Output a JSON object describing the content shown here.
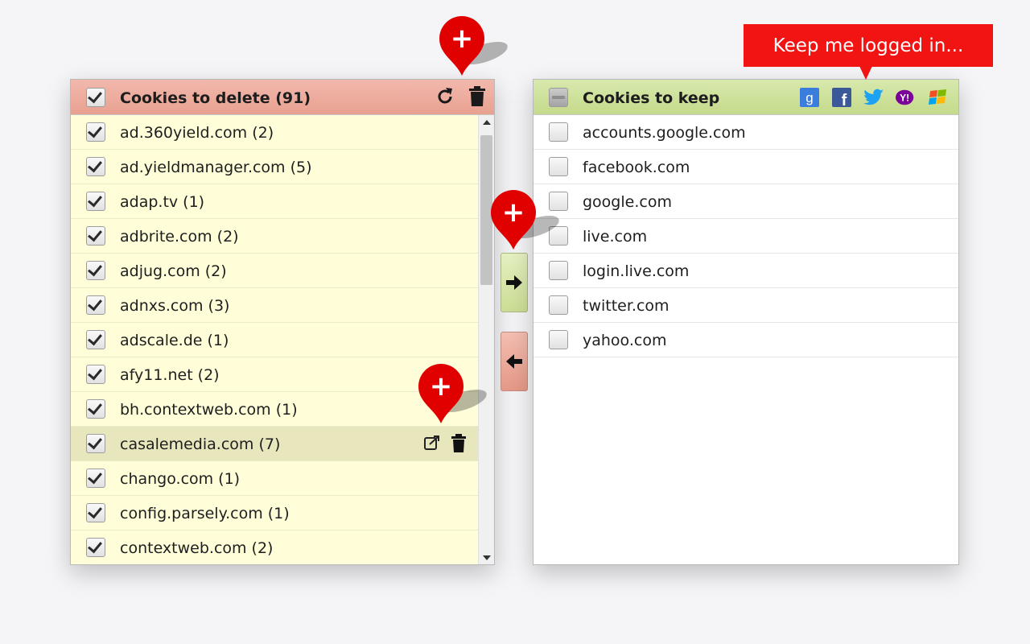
{
  "delete_panel": {
    "title": "Cookies to delete (91)",
    "items": [
      {
        "label": "ad.360yield.com (2)",
        "checked": true
      },
      {
        "label": "ad.yieldmanager.com (5)",
        "checked": true
      },
      {
        "label": "adap.tv (1)",
        "checked": true
      },
      {
        "label": "adbrite.com (2)",
        "checked": true
      },
      {
        "label": "adjug.com (2)",
        "checked": true
      },
      {
        "label": "adnxs.com (3)",
        "checked": true
      },
      {
        "label": "adscale.de (1)",
        "checked": true
      },
      {
        "label": "afy11.net (2)",
        "checked": true
      },
      {
        "label": "bh.contextweb.com (1)",
        "checked": true
      },
      {
        "label": "casalemedia.com (7)",
        "checked": true,
        "hovered": true
      },
      {
        "label": "chango.com (1)",
        "checked": true
      },
      {
        "label": "config.parsely.com (1)",
        "checked": true
      },
      {
        "label": "contextweb.com (2)",
        "checked": true
      }
    ],
    "header_icons": [
      "refresh-icon",
      "trash-icon"
    ],
    "row_action_icons": [
      "open-external-icon",
      "trash-icon"
    ]
  },
  "keep_panel": {
    "title": "Cookies to keep",
    "items": [
      {
        "label": "accounts.google.com",
        "checked": false
      },
      {
        "label": "facebook.com",
        "checked": false
      },
      {
        "label": "google.com",
        "checked": false
      },
      {
        "label": "live.com",
        "checked": false
      },
      {
        "label": "login.live.com",
        "checked": false
      },
      {
        "label": "twitter.com",
        "checked": false
      },
      {
        "label": "yahoo.com",
        "checked": false
      }
    ],
    "social_icons": [
      "google-icon",
      "facebook-icon",
      "twitter-icon",
      "yahoo-icon",
      "windows-icon"
    ],
    "social_glyphs": {
      "google": "g",
      "facebook": "f",
      "yahoo": "Y!"
    }
  },
  "callout": {
    "text": "Keep me logged in..."
  },
  "pin_icons": {
    "symbol": "+"
  },
  "colors": {
    "delete_header": "#e8a190",
    "keep_header": "#c4da8b",
    "delete_list_bg": "#fffed9",
    "callout_red": "#f21313",
    "pin_red": "#e00000"
  }
}
